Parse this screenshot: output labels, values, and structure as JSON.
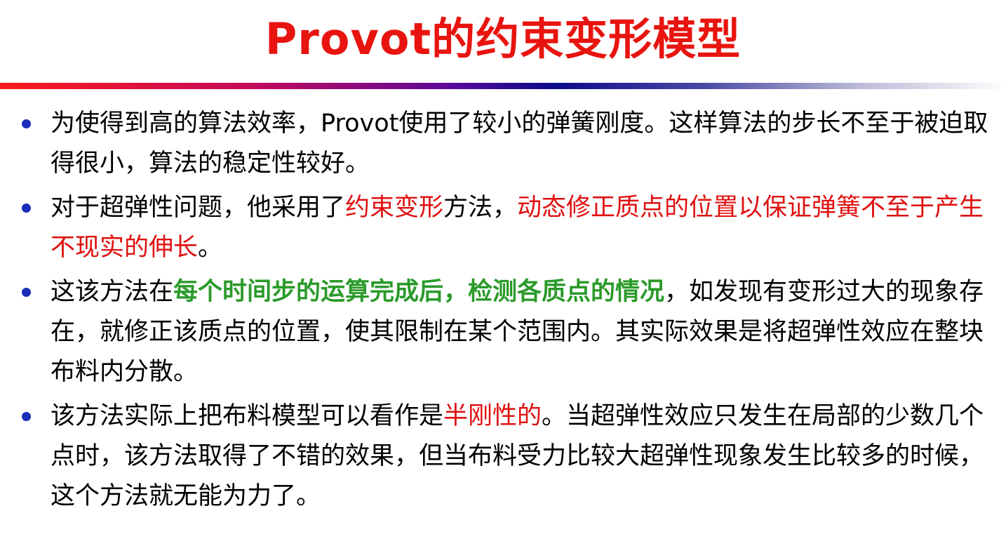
{
  "title": "Provot的约束变形模型",
  "colors": {
    "title": "#e8140f",
    "bullet": "#1a2db8",
    "highlight_red": "#e01010",
    "highlight_green": "#2a9a2a"
  },
  "bullets": [
    {
      "seg0": "为使得到高的算法效率，Provot使用了较小的弹簧刚度。这样算法的步长不至于被迫取得很小，算法的稳定性较好。"
    },
    {
      "seg0": "对于超弹性问题，他采用了",
      "seg1": "约束变形",
      "seg2": "方法，",
      "seg3": "动态修正质点的位置以保证弹簧不至于产生不现实的伸长",
      "seg4": "。"
    },
    {
      "seg0": "这该方法在",
      "seg1": "每个时间步的运算完成后，检测各质点的情况",
      "seg2": "，如发现有变形过大的现象存在，就修正该质点的位置，使其限制在某个范围内。其实际效果是将超弹性效应在整块布料内分散。"
    },
    {
      "seg0": "该方法实际上把布料模型可以看作是",
      "seg1": "半刚性的",
      "seg2": "。当超弹性效应只发生在局部的少数几个点时，该方法取得了不错的效果，但当布料受力比较大超弹性现象发生比较多的时候，这个方法就无能为力了。"
    }
  ]
}
